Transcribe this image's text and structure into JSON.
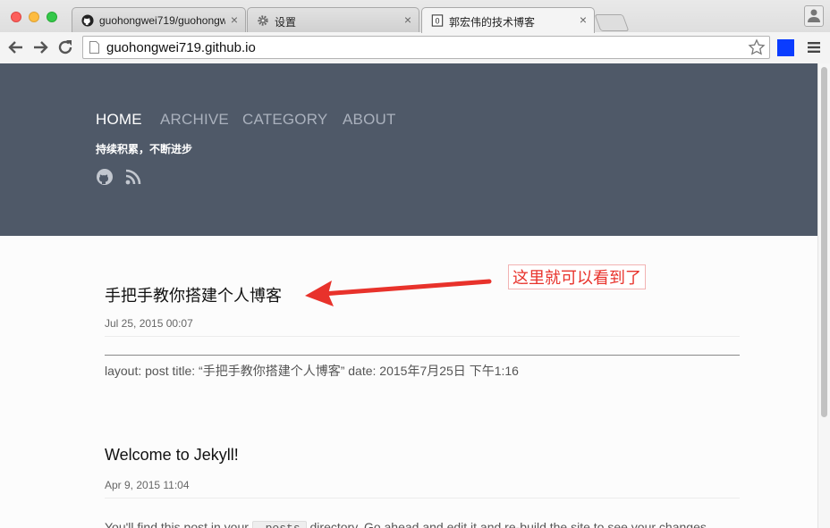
{
  "browser": {
    "tabs": [
      {
        "title": "guohongwei719/guohongw",
        "icon": "github-icon"
      },
      {
        "title": "设置",
        "icon": "gear-icon"
      },
      {
        "title": "郭宏伟的技术博客",
        "icon": "page-icon"
      }
    ],
    "active_tab": 2,
    "address": "guohongwei719.github.io"
  },
  "site": {
    "nav": [
      "HOME",
      "ARCHIVE",
      "CATEGORY",
      "ABOUT"
    ],
    "active_nav": "HOME",
    "tagline": "持续积累，不断进步",
    "social": [
      "github-icon",
      "rss-icon"
    ]
  },
  "posts": [
    {
      "title": "手把手教你搭建个人博客",
      "date": "Jul 25, 2015 00:07",
      "excerpt": "layout: post title: “手把手教你搭建个人博客” date: 2015年7月25日 下午1:16"
    },
    {
      "title": "Welcome to Jekyll!",
      "date": "Apr 9, 2015 11:04",
      "excerpt_before": "You'll find this post in your",
      "excerpt_code": "_posts",
      "excerpt_after": "directory. Go ahead and edit it and re-build the site to see your changes."
    }
  ],
  "annotation": {
    "text": "这里就可以看到了",
    "color": "#e8322b"
  },
  "colors": {
    "hero_bg": "#4f5968",
    "nav_inactive": "#aab1bd",
    "extension_square": "#0a3cff"
  }
}
